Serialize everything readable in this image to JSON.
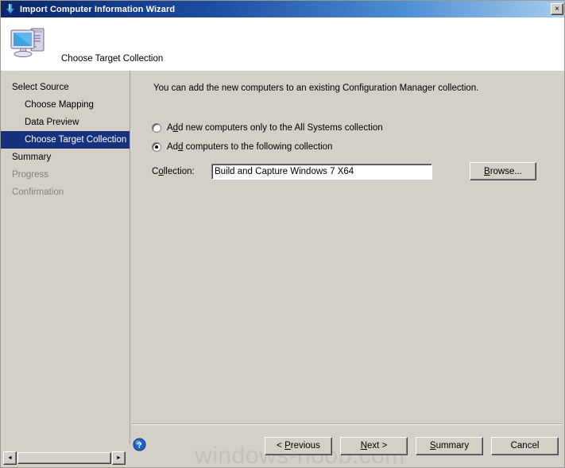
{
  "window": {
    "title": "Import Computer Information Wizard",
    "title_icon": "import-arrow-icon",
    "close_label": "×",
    "titlebar_color": "#0a246a",
    "body_color": "#d4d0c8"
  },
  "header": {
    "title": "Choose Target Collection",
    "icon": "computer-icon"
  },
  "sidebar": {
    "items": [
      {
        "label": "Select Source",
        "level": 0,
        "state": "normal"
      },
      {
        "label": "Choose Mapping",
        "level": 1,
        "state": "normal"
      },
      {
        "label": "Data Preview",
        "level": 1,
        "state": "normal"
      },
      {
        "label": "Choose Target Collection",
        "level": 1,
        "state": "selected"
      },
      {
        "label": "Summary",
        "level": 0,
        "state": "normal"
      },
      {
        "label": "Progress",
        "level": 0,
        "state": "disabled"
      },
      {
        "label": "Confirmation",
        "level": 0,
        "state": "disabled"
      }
    ],
    "selected_color": "#16327d",
    "disabled_color": "#868379",
    "scrollbar": {
      "left_arrow": "◄",
      "right_arrow": "►"
    }
  },
  "content": {
    "intro": "You can add the new computers to an existing Configuration Manager collection.",
    "radios": [
      {
        "prefix": "A",
        "accelerator": "d",
        "suffix": "d new computers only to the All Systems collection",
        "checked": false
      },
      {
        "prefix": "Ad",
        "accelerator": "d",
        "suffix": " computers to the following collection",
        "checked": true
      }
    ],
    "collection": {
      "label_prefix": "C",
      "label_accelerator": "o",
      "label_suffix": "llection:",
      "value": "Build and Capture Windows 7 X64",
      "placeholder": "",
      "browse": {
        "prefix": "",
        "accelerator": "B",
        "suffix": "rowse..."
      }
    }
  },
  "footer": {
    "help_icon": "help-question-icon",
    "buttons": [
      {
        "prefix": "< ",
        "accelerator": "P",
        "suffix": "revious"
      },
      {
        "prefix": "",
        "accelerator": "N",
        "suffix": "ext >"
      },
      {
        "prefix": "",
        "accelerator": "S",
        "suffix": "ummary"
      },
      {
        "prefix": "Cancel",
        "accelerator": "",
        "suffix": ""
      }
    ],
    "watermark": "windows-noob.com"
  }
}
